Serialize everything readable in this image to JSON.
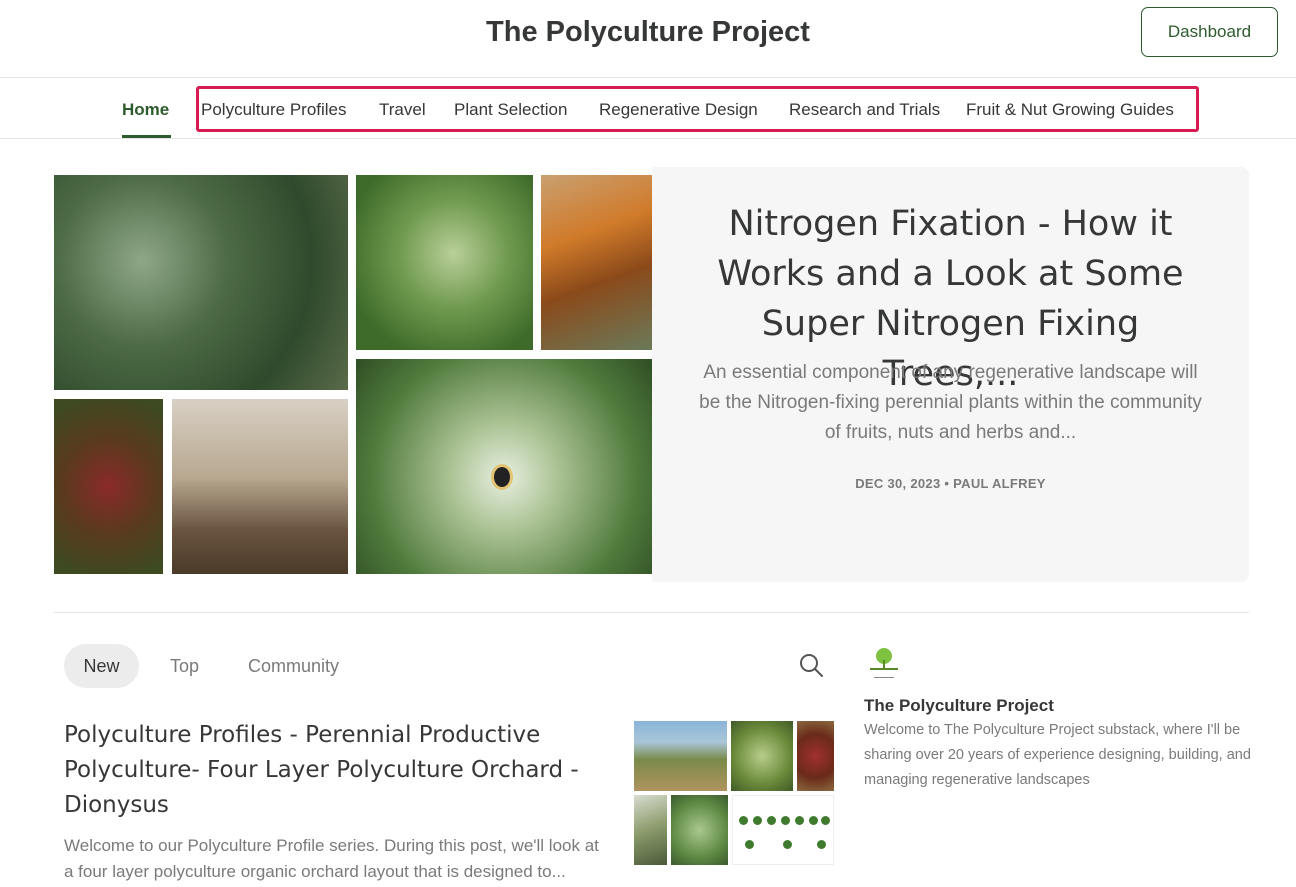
{
  "header": {
    "site_title": "The Polyculture Project",
    "dashboard_label": "Dashboard"
  },
  "nav": {
    "items": [
      {
        "label": "Home"
      },
      {
        "label": "Polyculture Profiles"
      },
      {
        "label": "Travel"
      },
      {
        "label": "Plant Selection"
      },
      {
        "label": "Regenerative Design"
      },
      {
        "label": "Research and Trials"
      },
      {
        "label": "Fruit & Nut Growing Guides"
      }
    ],
    "active_color": "#2e5b2e",
    "highlight_color": "#d81b50"
  },
  "hero": {
    "title": "Nitrogen Fixation - How it Works and a Look at Some Super Nitrogen Fixing Trees,...",
    "description": "An essential component of any regenerative landscape will be the Nitrogen-fixing perennial plants within the community of fruits, nuts and herbs and...",
    "meta": "DEC 30, 2023 • PAUL ALFREY"
  },
  "feed": {
    "tabs": [
      {
        "label": "New"
      },
      {
        "label": "Top"
      },
      {
        "label": "Community"
      }
    ],
    "search_icon": "search-icon",
    "post": {
      "title": "Polyculture Profiles - Perennial Productive Polyculture- Four Layer Polyculture Orchard - Dionysus",
      "excerpt": "Welcome to our Polyculture Profile series. During this post, we'll look at a four layer polyculture organic orchard layout that is designed to..."
    }
  },
  "sidebar": {
    "pub_name": "The Polyculture Project",
    "pub_desc": "Welcome to The Polyculture Project substack, where I'll be sharing over 20 years of experience designing, building, and managing regenerative landscapes"
  }
}
